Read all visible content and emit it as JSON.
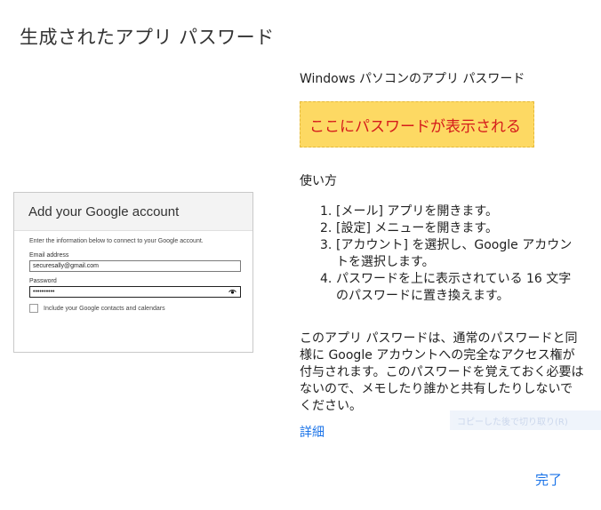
{
  "page": {
    "title": "生成されたアプリ パスワード",
    "section_heading": "Windows パソコンのアプリ パスワード",
    "password_placeholder": "ここにパスワードが表示される",
    "howto_heading": "使い方",
    "steps": [
      {
        "num": "1.",
        "text": "[メール] アプリを開きます。"
      },
      {
        "num": "2.",
        "text": "[設定] メニューを開きます。"
      },
      {
        "num": "3.",
        "text": "[アカウント] を選択し、Google アカウントを選択します。"
      },
      {
        "num": "4.",
        "text": "パスワードを上に表示されている 16 文字のパスワードに置き換えます。"
      }
    ],
    "description": "このアプリ パスワードは、通常のパスワードと同様に Google アカウントへの完全なアクセス権が付与されます。このパスワードを覚えておく必要はないので、メモしたり誰かと共有したりしないでください。",
    "details_link": "詳細",
    "done_button": "完了",
    "ghost_tip": "コピーした後で切り取り(R)"
  },
  "dialog": {
    "title": "Add your Google account",
    "intro": "Enter the information below to connect to your Google account.",
    "email_label": "Email address",
    "email_value": "securesally@gmail.com",
    "password_label": "Password",
    "password_value": "••••••••••",
    "checkbox_label": "Include your Google contacts and calendars"
  }
}
